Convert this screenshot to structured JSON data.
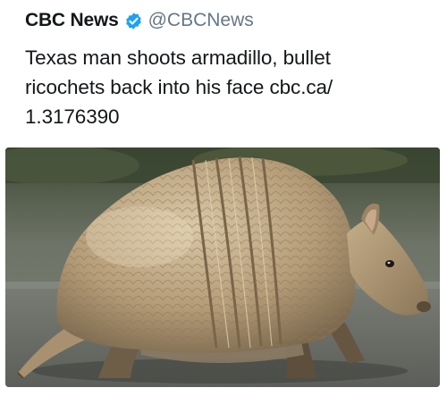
{
  "tweet": {
    "author_name": "CBC News",
    "author_handle": "@CBCNews",
    "verified_icon": "verified-badge-icon",
    "text": "Texas man shoots armadillo, bullet\nricochets back into his face cbc.ca/\n1.3176390",
    "media": {
      "icon": "armadillo-photo"
    }
  },
  "colors": {
    "verified": "#1da1f2",
    "handle": "#657786",
    "text": "#14171a"
  }
}
